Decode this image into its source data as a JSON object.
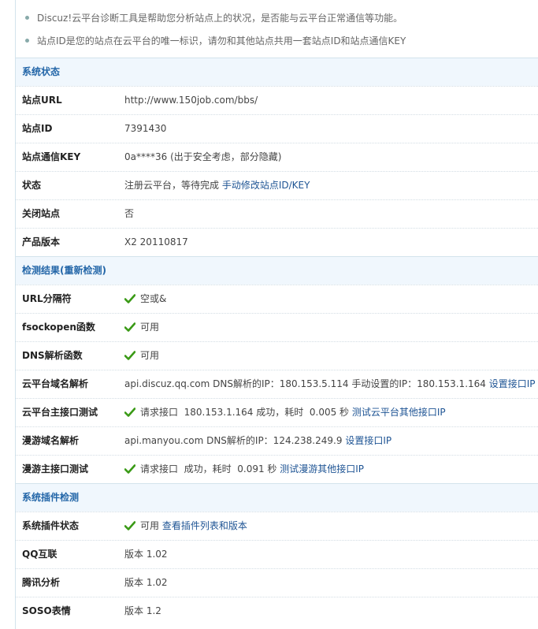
{
  "tips": [
    "Discuz!云平台诊断工具是帮助您分析站点上的状况，是否能与云平台正常通信等功能。",
    "站点ID是您的站点在云平台的唯一标识，请勿和其他站点共用一套站点ID和站点通信KEY"
  ],
  "system_status": {
    "title": "系统状态",
    "site_url": {
      "label": "站点URL",
      "value": "http://www.150job.com/bbs/"
    },
    "site_id": {
      "label": "站点ID",
      "value": "7391430"
    },
    "site_key": {
      "label": "站点通信KEY",
      "value": "0a****36 (出于安全考虑，部分隐藏)"
    },
    "status": {
      "label": "状态",
      "value": "注册云平台，等待完成",
      "link": "手动修改站点ID/KEY"
    },
    "site_closed": {
      "label": "关闭站点",
      "value": "否"
    },
    "product_version": {
      "label": "产品版本",
      "value": "X2 20110817"
    }
  },
  "check_results": {
    "title": "检测结果",
    "recheck": "(重新检测)",
    "url_separator": {
      "label": "URL分隔符",
      "value": "空或&"
    },
    "fsockopen": {
      "label": "fsockopen函数",
      "value": "可用"
    },
    "dns_func": {
      "label": "DNS解析函数",
      "value": "可用"
    },
    "cloud_dns": {
      "label": "云平台域名解析",
      "value": "api.discuz.qq.com DNS解析的IP：180.153.5.114 手动设置的IP：180.153.1.164",
      "link": "设置接口IP"
    },
    "cloud_api": {
      "label": "云平台主接口测试",
      "value": "请求接口  180.153.1.164 成功，耗时  0.005 秒",
      "link": "测试云平台其他接口IP"
    },
    "manyou_dns": {
      "label": "漫游域名解析",
      "value": "api.manyou.com DNS解析的IP：124.238.249.9",
      "link": "设置接口IP"
    },
    "manyou_api": {
      "label": "漫游主接口测试",
      "value": "请求接口  成功，耗时  0.091 秒",
      "link": "测试漫游其他接口IP"
    }
  },
  "plugin_check": {
    "title": "系统插件检测",
    "plugin_status": {
      "label": "系统插件状态",
      "value": "可用",
      "link": "查看插件列表和版本"
    },
    "qq_connect": {
      "label": "QQ互联",
      "value": "版本 1.02"
    },
    "tencent_analytics": {
      "label": "腾讯分析",
      "value": "版本 1.02"
    },
    "soso_emoji": {
      "label": "SOSO表情",
      "value": "版本 1.2"
    }
  },
  "colors": {
    "section_bg": "#f0f7fd",
    "section_title": "#2366a8",
    "link": "#1e5494",
    "check_green": "#3a9a16"
  },
  "icons": {
    "status_ok": "check-icon"
  }
}
